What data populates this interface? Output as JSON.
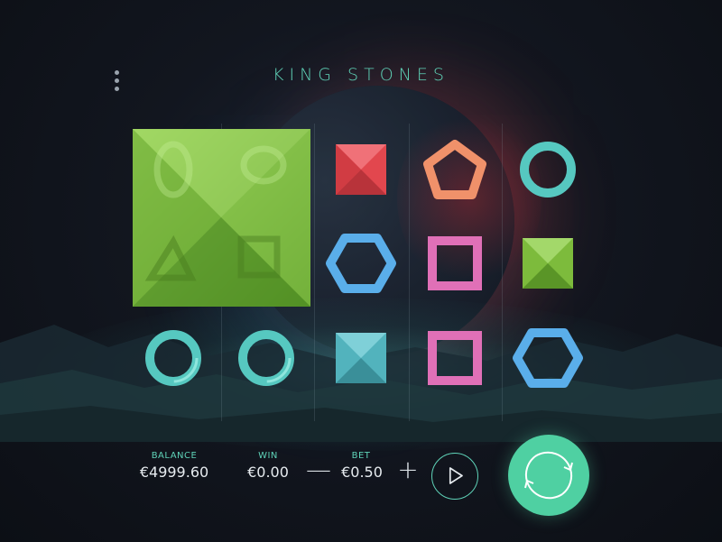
{
  "game": {
    "title": "KING STONES"
  },
  "menu": {
    "icon": "kebab-menu-icon"
  },
  "reels": [
    [
      "big-green-square",
      "teal-ring"
    ],
    [
      "big-green-square",
      "teal-ring"
    ],
    [
      "red-square",
      "blue-hexagon",
      "teal-square"
    ],
    [
      "orange-pentagon",
      "pink-square-frame",
      "pink-square-frame"
    ],
    [
      "teal-ring",
      "green-square",
      "blue-hexagon"
    ]
  ],
  "controls": {
    "balance_label": "BALANCE",
    "balance_value": "€4999.60",
    "win_label": "WIN",
    "win_value": "€0.00",
    "bet_label": "BET",
    "bet_value": "€0.50",
    "minus_label": "—",
    "plus_label": "+",
    "autoplay_icon": "play-icon",
    "spin_icon": "spin-arrows-icon"
  },
  "colors": {
    "accent": "#5fd3b8",
    "spin_button": "#4fd0a2"
  }
}
